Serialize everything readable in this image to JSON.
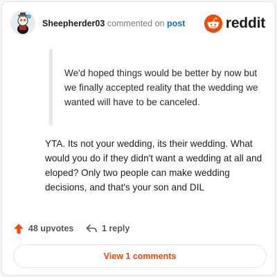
{
  "header": {
    "username": "Sheepherder03",
    "commented_on": "commented on",
    "post_link": "post",
    "brand": "reddit"
  },
  "quote": {
    "text": "We'd hoped things would be better by now but we finally accepted reality that the wedding we wanted will have to be canceled."
  },
  "comment": {
    "text": "YTA. Its not your wedding, its their wedding. What would you do if they didn't want a wedding at all and eloped? Only two people can make wedding decisions, and that's your son and DIL"
  },
  "actions": {
    "upvotes": "48 upvotes",
    "reply": "1 reply"
  },
  "footer": {
    "view_comments": "View 1 comments"
  },
  "colors": {
    "brand": "#ff4500",
    "link": "#0079d3"
  }
}
